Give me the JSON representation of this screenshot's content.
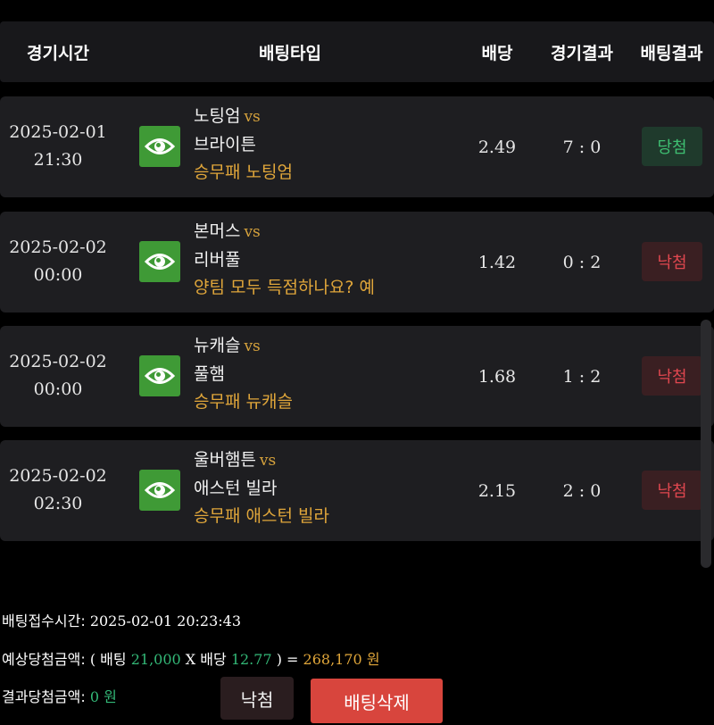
{
  "header": {
    "time": "경기시간",
    "bet_type": "배팅타입",
    "odds": "배당",
    "match_result": "경기결과",
    "bet_result": "배팅결과"
  },
  "rows": [
    {
      "date": "2025-02-01",
      "time": "21:30",
      "home": "노팅엄",
      "vs": "vs",
      "away": "브라이튼",
      "pick": "승무패 노팅엄",
      "odds": "2.49",
      "score": "7 : 0",
      "result": "당첨",
      "status": "win"
    },
    {
      "date": "2025-02-02",
      "time": "00:00",
      "home": "본머스",
      "vs": "vs",
      "away": "리버풀",
      "pick": "양팀 모두 득점하나요? 예",
      "odds": "1.42",
      "score": "0 : 2",
      "result": "낙첨",
      "status": "lose"
    },
    {
      "date": "2025-02-02",
      "time": "00:00",
      "home": "뉴캐슬",
      "vs": "vs",
      "away": "풀햄",
      "pick": "승무패 뉴캐슬",
      "odds": "1.68",
      "score": "1 : 2",
      "result": "낙첨",
      "status": "lose"
    },
    {
      "date": "2025-02-02",
      "time": "02:30",
      "home": "울버햄튼",
      "vs": "vs",
      "away": "애스턴 빌라",
      "pick": "승무패 애스턴 빌라",
      "odds": "2.15",
      "score": "2 : 0",
      "result": "낙첨",
      "status": "lose"
    }
  ],
  "summary": {
    "received_label": "배팅접수시간:",
    "received_value": "2025-02-01 20:23:43",
    "expected_label": "예상당첨금액:",
    "open_paren": "(",
    "bet_label": "배팅",
    "bet_amount": "21,000",
    "times": "X",
    "odds_label": "배당",
    "total_odds": "12.77",
    "close_eq": ") =",
    "expected_amount": "268,170",
    "won": "원",
    "result_label": "결과당첨금액:",
    "result_amount": "0",
    "result_won": "원"
  },
  "buttons": {
    "status": "낙첨",
    "delete": "배팅삭제"
  },
  "colors": {
    "eye_button": "#3f9a36",
    "win": "#3fbf72",
    "lose": "#e0474f",
    "gold": "#e0a63a",
    "green": "#33b877",
    "delete": "#d8453d"
  }
}
